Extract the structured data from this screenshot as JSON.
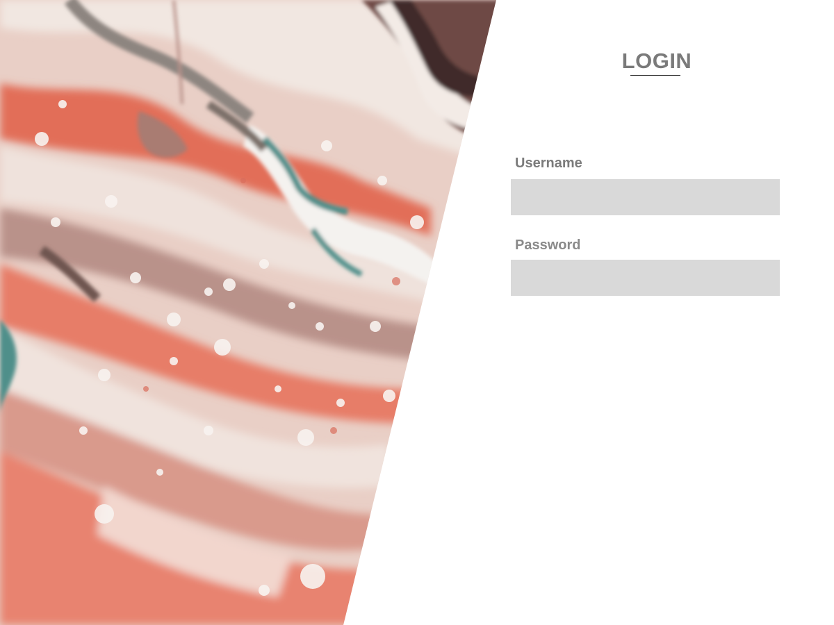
{
  "login": {
    "title": "LOGIN",
    "username_label": "Username",
    "username_value": "",
    "password_label": "Password",
    "password_value": ""
  },
  "colors": {
    "background": "#ffffff",
    "input_fill": "#d9d9d9",
    "label_text": "#7b7b7b",
    "title_text": "#7a7a7a",
    "underline": "#2b2b2b",
    "art_coral": "#e2705a",
    "art_cream": "#efe5df",
    "art_teal": "#4f8f8a",
    "art_brown": "#6e5550"
  },
  "hero": {
    "image_name": "marble-fluid-art-image"
  }
}
